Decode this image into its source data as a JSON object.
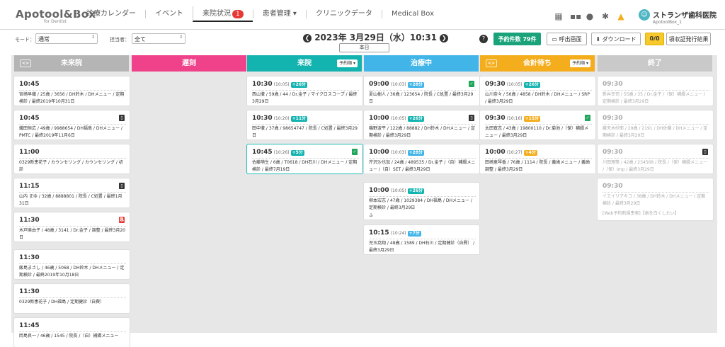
{
  "app": {
    "logo": "Apotool&Box",
    "logo_sub": "for Dentist"
  },
  "nav": {
    "items": [
      {
        "label": "診療カレンダー"
      },
      {
        "label": "イベント"
      },
      {
        "label": "来院状況",
        "badge": "1",
        "active": true
      },
      {
        "label": "患者管理 ▾"
      },
      {
        "label": "クリニックデータ"
      },
      {
        "label": "Medical Box"
      }
    ],
    "icons": [
      "building-icon",
      "apps-grid-icon",
      "help-icon",
      "settings-icon",
      "bell-icon"
    ],
    "clinic": {
      "name": "ストランザ歯科医院",
      "id": "ApotoolBox_1",
      "avatar": "☺"
    }
  },
  "toolbar": {
    "mode_label": "モード：",
    "mode_value": "通常",
    "staff_label": "担当者：",
    "staff_value": "全て",
    "date": "2023年 3月29日（水）10:31",
    "prev": "❮",
    "next": "❯",
    "today": "本日",
    "help": "?",
    "reservations": "予約件数 79件",
    "call_screen": "呼出画面",
    "download": "ダウンロード",
    "receipt_count": "0/0",
    "receipt_label": "領収証発行結果"
  },
  "columns": [
    {
      "id": "not-arrived",
      "title": "未来院",
      "color": "#b5b5b5",
      "icon": "<>",
      "badge": ""
    },
    {
      "id": "late",
      "title": "遅刻",
      "color": "#f0428a",
      "icon": "",
      "badge": ""
    },
    {
      "id": "arrived",
      "title": "来院",
      "color": "#13b3b0",
      "icon": "",
      "badge": "予約順 ▾"
    },
    {
      "id": "treatment",
      "title": "治療中",
      "color": "#42b5e8",
      "icon": "",
      "badge": ""
    },
    {
      "id": "checkout",
      "title": "会計待ち",
      "color": "#f4ad1c",
      "icon": "<>",
      "badge": "予約順 ▾"
    },
    {
      "id": "finished",
      "title": "終了",
      "color": "#c9c9c9",
      "icon": "",
      "badge": ""
    }
  ],
  "cards": {
    "not_arrived": [
      {
        "time": "10:45",
        "icons": "",
        "text": "宮崎早織 / 25歳 / 3656 / DH鈴木 / DHメニュー / 定期検診 / 最終2019年10月31日"
      },
      {
        "time": "10:45",
        "icons": "▯",
        "text": "織田恒広 / 49歳 / 9988654 / DH福島 / DHメニュー / PMTC / 最終2019年11月6日"
      },
      {
        "time": "11:00",
        "icons": "",
        "text": "0329新患花子 / カウンセリング / カウンセリング / 初診"
      },
      {
        "time": "11:15",
        "icons": "▯",
        "text": "山内 まゆ / 32歳 / 8888801 / 院長 / C処置 / 最終1月31日"
      },
      {
        "time": "11:30",
        "icons": "急",
        "text": "木戸麻由子 / 48歳 / 3141 / Dr.金子 / 調整 / 最終3月20日"
      },
      {
        "time": "11:30",
        "icons": "",
        "text": "飯島まさし / 46歳 / 5068 / DH鈴木 / DHメニュー / 定期検診 / 最終2019年10月18日"
      },
      {
        "time": "11:30",
        "icons": "",
        "text": "0329新患花子 / DH福島 / 定期健診（自費）"
      },
      {
        "time": "11:45",
        "icons": "",
        "text": "岡島良一 / 46歳 / 1545 / 院長 /（自）補綴メニュー"
      }
    ],
    "arrived": [
      {
        "time": "10:30",
        "sub": "(10:05)",
        "delta": "+26分",
        "icons": "",
        "text": "西山徹 / 59歳 / 44 / Dr.金子 / マイクロスコープ / 最終3月29日"
      },
      {
        "time": "10:30",
        "sub": "(10:20)",
        "delta": "+11分",
        "icons": "",
        "text": "田中徹 / 37歳 / 98654747 / 院長 / C処置 / 最終3月29日"
      },
      {
        "time": "10:45",
        "sub": "(10:26)",
        "delta": "+5分",
        "icons": "✓",
        "text": "佐藤萌生 / 6歳 / T0618 / DH石川 / DHメニュー / 定期検診 / 最終7月19日"
      }
    ],
    "treatment": [
      {
        "time": "09:00",
        "sub": "(10:03)",
        "delta": "+28分",
        "icons": "✓",
        "text": "夏山樹人 / 36歳 / 123654 / 院長 / C処置 / 最終3月29日"
      },
      {
        "time": "10:00",
        "sub": "(10:05)",
        "delta": "+26分",
        "icons": "▯",
        "text": "磯野波平 / 122歳 / 88882 / DH鈴木 / DHメニュー / 定期検診 / 最終3月29日"
      },
      {
        "time": "10:00",
        "sub": "(10:03)",
        "delta": "+28分",
        "icons": "",
        "text": "芹沢沙也加 / 24歳 / 489535 / Dr.金子 /（自）補綴メニュー /（自）SET / 最終3月29日"
      },
      {
        "time": "10:00",
        "sub": "(10:05)",
        "delta": "+26分",
        "icons": "",
        "text": "柳本宏志 / 47歳 / 1029384 / DH福島 / DHメニュー / 定期検診 / 最終3月29日",
        "note": "ふ"
      },
      {
        "time": "10:15",
        "sub": "(10:24)",
        "delta": "+7分",
        "icons": "",
        "text": "児玉尭翔 / 48歳 / 1589 / DH石川 / 定期健診（自費） / 最終3月29日"
      }
    ],
    "checkout": [
      {
        "time": "09:30",
        "sub": "(10:05)",
        "delta": "+26分",
        "icons": "",
        "text": "山川奈々 / 56歳 / 4858 / DH鈴木 / DHメニュー / SRP / 最終3月29日"
      },
      {
        "time": "09:30",
        "sub": "(10:16)",
        "delta": "+15分",
        "icons": "✓",
        "text": "太田寛志 / 43歳 / 19800110 / Dr.菊池 /（保）補綴メニュー / 最終3月29日"
      },
      {
        "time": "10:00",
        "sub": "(10:27)",
        "delta": "+4分",
        "icons": "",
        "text": "田崎恵琴香 / 76歳 / 1114 / 院長 / 義歯メニュー / 義歯調整 / 最終3月29日"
      }
    ],
    "finished": [
      {
        "time": "09:30",
        "icons": "",
        "text": "新井幸司 / 55歳 / 35 / Dr.金子 /（保）補綴メニュー / 定期検診 / 最終3月29日"
      },
      {
        "time": "09:30",
        "icons": "",
        "text": "藤天木紗耶 / 29歳 / 2191 / DH佐藤 / DHメニュー / 定期検診 / 最終3月29日"
      },
      {
        "time": "09:30",
        "icons": "▯",
        "text": "川田理策 / 42歳 / 234568 / 院長 /（保）補綴メニュー /（保）Imp / 最終3月29日"
      },
      {
        "time": "09:30",
        "icons": "",
        "text": "イエイリアキコ / 38歳 / DH鈴木 / DHメニュー / 定期検診 / 最終3月29日",
        "note": "[Web予約新規患者]【歯を白くしたい】"
      }
    ]
  }
}
